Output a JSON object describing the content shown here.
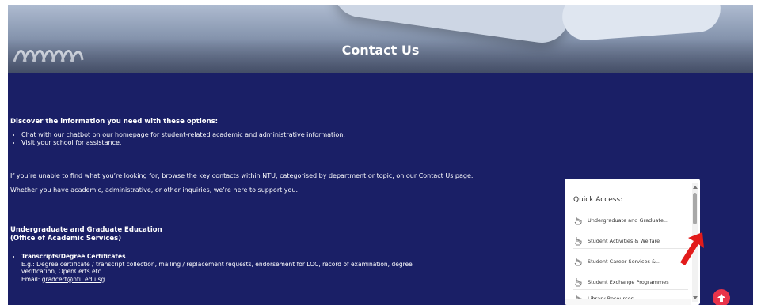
{
  "hero": {
    "title": "Contact Us"
  },
  "intro": {
    "heading": "Discover the information you need with these options:",
    "bullets": [
      "Chat with our chatbot on our homepage for student-related academic and administrative information.",
      "Visit your school for assistance."
    ]
  },
  "paragraph": {
    "line1": "If you’re unable to find what you’re looking for, browse the key contacts within NTU, categorised by department or topic, on our Contact Us page.",
    "line2": "Whether you have academic, administrative, or other inquiries, we’re here to support you."
  },
  "section": {
    "title_line1": "Undergraduate and Graduate Education",
    "title_line2": "(Office of Academic Services)",
    "items": [
      {
        "title": "Transcripts/Degree Certificates",
        "desc_line1": "E.g.: Degree certificate / transcript collection, mailing / replacement requests, endorsement for LOC, record of examination, degree",
        "desc_line2": "verification, OpenCerts etc",
        "email_label": "Email: ",
        "email": "gradcert@ntu.edu.sg"
      }
    ]
  },
  "quick_access": {
    "title": "Quick Access:",
    "items": [
      "Undergraduate and Graduate...",
      "Student Activities & Welfare",
      "Student Career Services &...",
      "Student Exchange Programmes",
      "Library Resources"
    ]
  },
  "colors": {
    "page_bg": "#1a1f66",
    "accent_red": "#e8334a",
    "panel_bg": "#ffffff"
  },
  "icons": {
    "qa_item": "pointer-hand-icon",
    "back_to_top": "arrow-up-circle-icon",
    "annotation": "red-arrow-icon"
  }
}
